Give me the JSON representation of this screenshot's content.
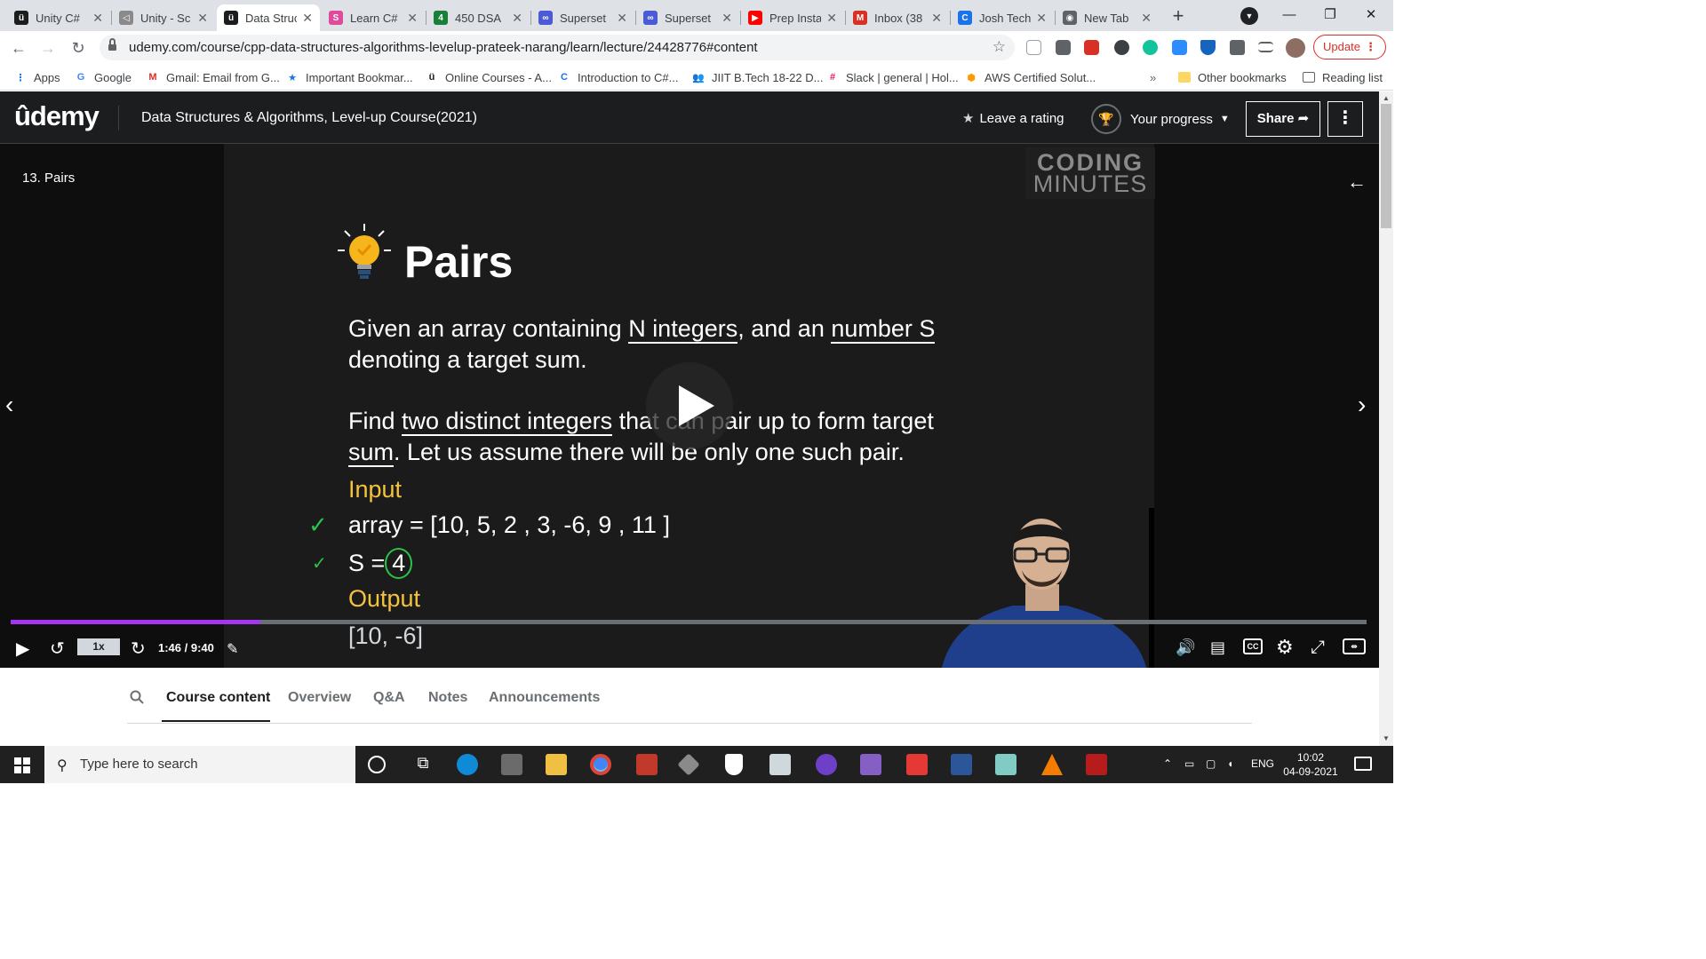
{
  "browser": {
    "tabs": [
      {
        "title": "Unity C#",
        "fav_color": "#1c1d1f",
        "fav_glyph": "ü"
      },
      {
        "title": "Unity - Sc",
        "fav_color": "#8a8a8a",
        "fav_glyph": "◁"
      },
      {
        "title": "Data Struc",
        "fav_color": "#1c1d1f",
        "fav_glyph": "ü",
        "active": true
      },
      {
        "title": "Learn C#",
        "fav_color": "#e04a9b",
        "fav_glyph": "S"
      },
      {
        "title": "450 DSA",
        "fav_color": "#188038",
        "fav_glyph": "4"
      },
      {
        "title": "Superset",
        "fav_color": "#4b5bd6",
        "fav_glyph": "∞"
      },
      {
        "title": "Superset",
        "fav_color": "#4b5bd6",
        "fav_glyph": "∞"
      },
      {
        "title": "Prep Insta",
        "fav_color": "#ff0000",
        "fav_glyph": "▶"
      },
      {
        "title": "Inbox (38",
        "fav_color": "#d93025",
        "fav_glyph": "M"
      },
      {
        "title": "Josh Tech",
        "fav_color": "#1a73e8",
        "fav_glyph": "C"
      },
      {
        "title": "New Tab",
        "fav_color": "#5f6368",
        "fav_glyph": "◉"
      }
    ],
    "url": "udemy.com/course/cpp-data-structures-algorithms-levelup-prateek-narang/learn/lecture/24428776#content",
    "update_label": "Update",
    "bookmarks": [
      {
        "label": "Apps",
        "color": "#1a73e8",
        "glyph": "⋮"
      },
      {
        "label": "Google",
        "color": "#4285f4",
        "glyph": "G"
      },
      {
        "label": "Gmail: Email from G...",
        "color": "#d93025",
        "glyph": "M"
      },
      {
        "label": "Important Bookmar...",
        "color": "#1a73e8",
        "glyph": "★"
      },
      {
        "label": "Online Courses - A...",
        "color": "#1c1d1f",
        "glyph": "ü"
      },
      {
        "label": "Introduction to C#...",
        "color": "#1a73e8",
        "glyph": "C"
      },
      {
        "label": "JIIT B.Tech 18-22 D...",
        "color": "#5b5fc7",
        "glyph": "👥"
      },
      {
        "label": "Slack | general | Hol...",
        "color": "#e01e5a",
        "glyph": "#"
      },
      {
        "label": "AWS Certified Solut...",
        "color": "#ff9900",
        "glyph": "⬢"
      }
    ],
    "bookmarks_more": "»",
    "other_bookmarks": "Other bookmarks",
    "reading_list": "Reading list"
  },
  "udemy": {
    "logo": "ûdemy",
    "course_title": "Data Structures & Algorithms, Level-up Course(2021)",
    "leave_rating": "Leave a rating",
    "your_progress": "Your progress",
    "share_label": "Share",
    "more_label": "⋮"
  },
  "lecture": {
    "title": "13. Pairs",
    "watermark_top": "CODING",
    "watermark_bottom": "MINUTES",
    "slide_title": "Pairs",
    "p1_a": "Given an array containing ",
    "p1_u1": "N integers",
    "p1_b": ", and an ",
    "p1_u2": "number S",
    "p1_line2": "denoting a target sum.",
    "p2_a": "Find ",
    "p2_u1": "two distinct integers",
    "p2_b": " that can pair up to form target",
    "p2_u2": "sum",
    "p2_c": ". Let us assume there will be only one such pair.",
    "input_label": "Input",
    "array_line": "array = [10, 5, 2 , 3, -6, 9 , 11 ]",
    "s_prefix": "S =",
    "s_value": "4",
    "output_label": "Output",
    "output_value": "[10, -6]"
  },
  "player": {
    "progress": 0.184,
    "speed": "1x",
    "time": "1:46 / 9:40"
  },
  "course_tabs": [
    "Course content",
    "Overview",
    "Q&A",
    "Notes",
    "Announcements"
  ],
  "taskbar": {
    "search_placeholder": "Type here to search",
    "lang": "ENG",
    "time": "10:02",
    "date": "04-09-2021"
  }
}
